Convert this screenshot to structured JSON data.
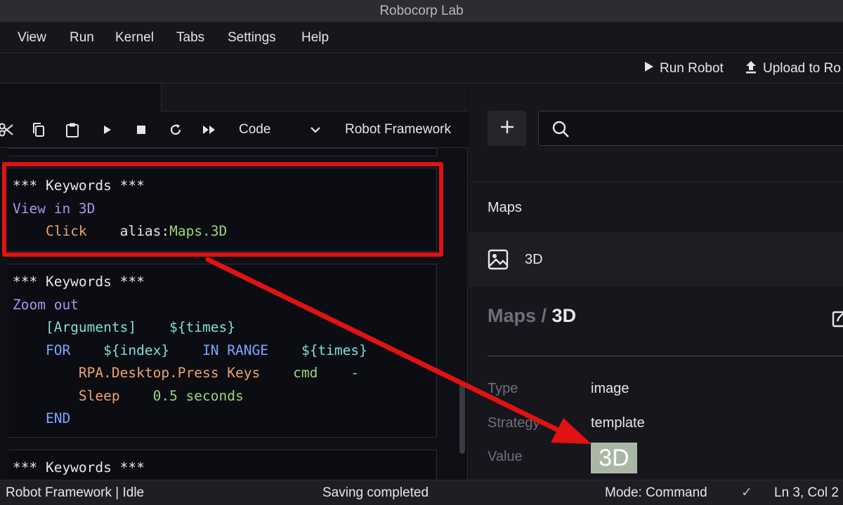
{
  "window": {
    "title": "Robocorp Lab"
  },
  "menu": {
    "items": [
      "View",
      "Run",
      "Kernel",
      "Tabs",
      "Settings",
      "Help"
    ]
  },
  "robot_toolbar": {
    "run_robot": "Run Robot",
    "upload": "Upload to Ro"
  },
  "notebook_toolbar": {
    "icons": [
      "scissors-icon",
      "copy-icon",
      "clipboard-icon",
      "play-icon",
      "stop-icon",
      "restart-icon",
      "fast-forward-icon"
    ],
    "cell_type": "Code",
    "kernel_name": "Robot Framework"
  },
  "cells": [
    {
      "lines": [
        "*** Keywords ***",
        "View in 3D",
        "Click",
        "alias:",
        "Maps.3D"
      ]
    },
    {
      "lines": [
        "*** Keywords ***",
        "Zoom out",
        "[Arguments]",
        "${times}",
        "FOR",
        "${index}",
        "IN RANGE",
        "${times}",
        "RPA.Desktop.Press Keys",
        "cmd",
        "-",
        "Sleep",
        "0.5 seconds",
        "END"
      ]
    },
    {
      "lines": [
        "*** Keywords ***"
      ]
    }
  ],
  "locator_panel": {
    "search_placeholder": "",
    "group": "Maps",
    "item": "3D",
    "breadcrumb": {
      "parent": "Maps",
      "separator": " / ",
      "current": "3D"
    },
    "properties": {
      "type_key": "Type",
      "type_value": "image",
      "strategy_key": "Strategy",
      "strategy_value": "template",
      "value_key": "Value",
      "value_text": "3D"
    }
  },
  "status": {
    "left": "Robot Framework | Idle",
    "center": "Saving completed",
    "mode": "Mode: Command",
    "check": "✓",
    "position": "Ln 3, Col 2"
  },
  "colors": {
    "highlight_red": "#e01212",
    "keyword_purple": "#a796f0",
    "keyword_orange": "#f0a368",
    "arg_green": "#9bd47a"
  }
}
